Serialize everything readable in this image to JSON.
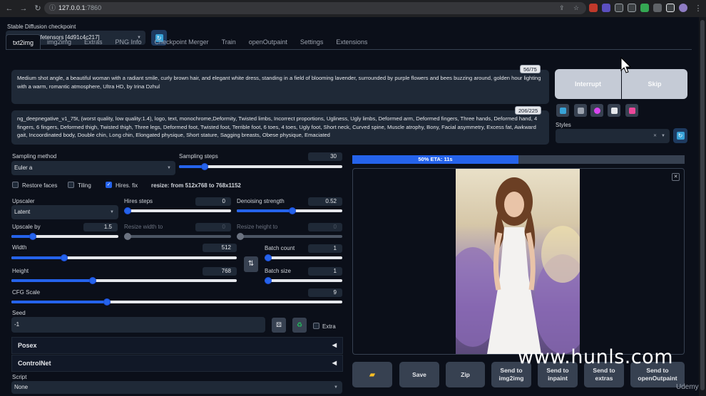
{
  "browser": {
    "url_host": "127.0.0.1",
    "url_port": ":7860"
  },
  "checkpoint": {
    "label": "Stable Diffusion checkpoint",
    "value": "lyriel_v15.safetensors [4d91c4c217]"
  },
  "tabs": [
    "txt2img",
    "img2img",
    "Extras",
    "PNG Info",
    "Checkpoint Merger",
    "Train",
    "openOutpaint",
    "Settings",
    "Extensions"
  ],
  "prompt": {
    "text": "Medium shot angle, a beautiful woman with a radiant smile, curly brown hair, and elegant white dress, standing in a field of blooming lavender, surrounded by purple flowers and bees buzzing around, golden hour lighting with a warm, romantic atmosphere, Ultra HD, by Irina Dzhul",
    "counter": "56/75"
  },
  "negative_prompt": {
    "text": "ng_deepnegative_v1_75t, (worst quality, low quality:1.4), logo, text, monochrome,Deformity, Twisted limbs, Incorrect proportions, Ugliness, Ugly limbs, Deformed arm, Deformed fingers, Three hands, Deformed hand, 4 fingers, 6 fingers, Deformed thigh, Twisted thigh, Three legs, Deformed foot, Twisted foot, Terrible foot, 6 toes, 4 toes, Ugly foot, Short neck, Curved spine, Muscle atrophy, Bony, Facial asymmetry, Excess fat, Awkward gait, Incoordinated body, Double chin, Long chin, Elongated physique, Short stature, Sagging breasts, Obese physique, Emaciated",
    "counter": "206/225"
  },
  "actions": {
    "interrupt": "Interrupt",
    "skip": "Skip",
    "styles_label": "Styles"
  },
  "sampling": {
    "method_label": "Sampling method",
    "method_value": "Euler a",
    "steps_label": "Sampling steps",
    "steps_value": "30",
    "steps_fraction": 0.2
  },
  "checkboxes": {
    "restore_faces": "Restore faces",
    "tiling": "Tiling",
    "hires_fix": "Hires. fix",
    "resize_info": "resize: from 512x768 to 768x1152"
  },
  "hires": {
    "upscaler_label": "Upscaler",
    "upscaler_value": "Latent",
    "hires_steps_label": "Hires steps",
    "hires_steps_value": "0",
    "denoise_label": "Denoising strength",
    "denoise_value": "0.52",
    "upscale_by_label": "Upscale by",
    "upscale_by_value": "1.5",
    "resize_w_label": "Resize width to",
    "resize_w_value": "0",
    "resize_h_label": "Resize height to",
    "resize_h_value": "0"
  },
  "size": {
    "width_label": "Width",
    "width_value": "512",
    "height_label": "Height",
    "height_value": "768",
    "batch_count_label": "Batch count",
    "batch_count_value": "1",
    "batch_size_label": "Batch size",
    "batch_size_value": "1",
    "cfg_label": "CFG Scale",
    "cfg_value": "9"
  },
  "seed": {
    "label": "Seed",
    "value": "-1",
    "extra_label": "Extra"
  },
  "accordions": [
    "Posex",
    "ControlNet"
  ],
  "script": {
    "label": "Script",
    "value": "None"
  },
  "progress": {
    "text": "50% ETA: 11s",
    "fraction": 0.5
  },
  "output_buttons": {
    "folder": "folder-icon",
    "save": "Save",
    "zip": "Zip",
    "send_img2img": "Send to img2img",
    "send_inpaint": "Send to inpaint",
    "send_extras": "Send to extras",
    "send_outpaint": "Send to openOutpaint"
  },
  "watermark": "www.hunls.com",
  "udemy": "Udemy"
}
